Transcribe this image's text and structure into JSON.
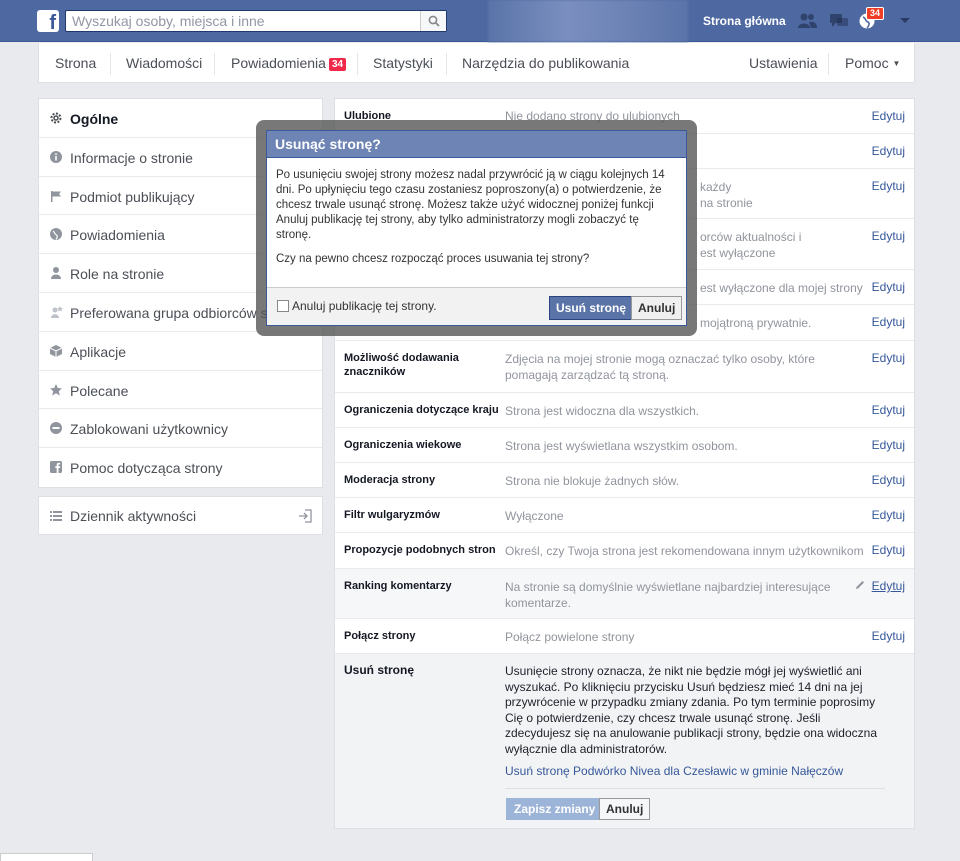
{
  "topbar": {
    "search_placeholder": "Wyszukaj osoby, miejsca i inne",
    "home": "Strona główna",
    "notif_count": "34"
  },
  "pagenav": {
    "strona": "Strona",
    "wiadomosci": "Wiadomości",
    "powiadomienia": "Powiadomienia",
    "powiadomienia_count": "34",
    "statystyki": "Statystyki",
    "narzedzia": "Narzędzia do publikowania",
    "ustawienia": "Ustawienia",
    "pomoc": "Pomoc"
  },
  "sidebar": {
    "items": [
      {
        "label": "Ogólne",
        "icon": "gear-icon"
      },
      {
        "label": "Informacje o stronie",
        "icon": "info-icon"
      },
      {
        "label": "Podmiot publikujący",
        "icon": "flag-icon"
      },
      {
        "label": "Powiadomienia",
        "icon": "globe-icon"
      },
      {
        "label": "Role na stronie",
        "icon": "person-icon"
      },
      {
        "label": "Preferowana grupa odbiorców strony",
        "icon": "audience-icon"
      },
      {
        "label": "Aplikacje",
        "icon": "cube-icon"
      },
      {
        "label": "Polecane",
        "icon": "star-icon"
      },
      {
        "label": "Zablokowani użytkownicy",
        "icon": "blocked-icon"
      },
      {
        "label": "Pomoc dotycząca strony",
        "icon": "facebook-icon"
      }
    ],
    "activity": "Dziennik aktywności"
  },
  "settings": {
    "edit": "Edytuj",
    "rows": [
      {
        "label": "Ulubione",
        "value": "Nie dodano strony do ulubionych"
      },
      {
        "label": "",
        "value": ""
      },
      {
        "label": "",
        "value": "każdy\nna stronie"
      },
      {
        "label": "",
        "value": "orców aktualności i\nest wyłączone"
      },
      {
        "label": "",
        "value": "est wyłączone dla mojej strony"
      },
      {
        "label": "",
        "value": "mojątroną prywatnie."
      },
      {
        "label": "Możliwość dodawania znaczników",
        "value": "Zdjęcia na mojej stronie mogą oznaczać tylko osoby, które pomagają zarządzać tą stroną."
      },
      {
        "label": "Ograniczenia dotyczące kraju",
        "value": "Strona jest widoczna dla wszystkich."
      },
      {
        "label": "Ograniczenia wiekowe",
        "value": "Strona jest wyświetlana wszystkim osobom."
      },
      {
        "label": "Moderacja strony",
        "value": "Strona nie blokuje żadnych słów."
      },
      {
        "label": "Filtr wulgaryzmów",
        "value": "Wyłączone"
      },
      {
        "label": "Propozycje podobnych stron",
        "value": "Określ, czy Twoja strona jest rekomendowana innym użytkownikom"
      },
      {
        "label": "Ranking komentarzy",
        "value": "Na stronie są domyślnie wyświetlane najbardziej interesujące komentarze."
      },
      {
        "label": "Połącz strony",
        "value": "Połącz powielone strony"
      }
    ],
    "delete": {
      "label": "Usuń stronę",
      "desc": "Usunięcie strony oznacza, że nikt nie będzie mógł jej wyświetlić ani wyszukać. Po kliknięciu przycisku Usuń będziesz mieć 14 dni na jej przywrócenie w przypadku zmiany zdania. Po tym terminie poprosimy Cię o potwierdzenie, czy chcesz trwale usunąć stronę. Jeśli zdecydujesz się na anulowanie publikacji strony, będzie ona widoczna wyłącznie dla administratorów.",
      "link": "Usuń stronę Podwórko Nivea dla Czesławic w gminie Nałęczów",
      "save": "Zapisz zmiany",
      "cancel": "Anuluj"
    }
  },
  "modal": {
    "title": "Usunąć stronę?",
    "p1": "Po usunięciu swojej strony możesz nadal przywrócić ją w ciągu kolejnych 14 dni. Po upłynięciu tego czasu zostaniesz poproszony(a) o potwierdzenie, że chcesz trwale usunąć stronę. Możesz także użyć widocznej poniżej funkcji Anuluj publikację tej strony, aby tylko administratorzy mogli zobaczyć tę stronę.",
    "p2": "Czy na pewno chcesz rozpocząć proces usuwania tej strony?",
    "checkbox": "Anuluj publikację tej strony.",
    "delete_btn": "Usuń stronę",
    "cancel_btn": "Anuluj"
  }
}
